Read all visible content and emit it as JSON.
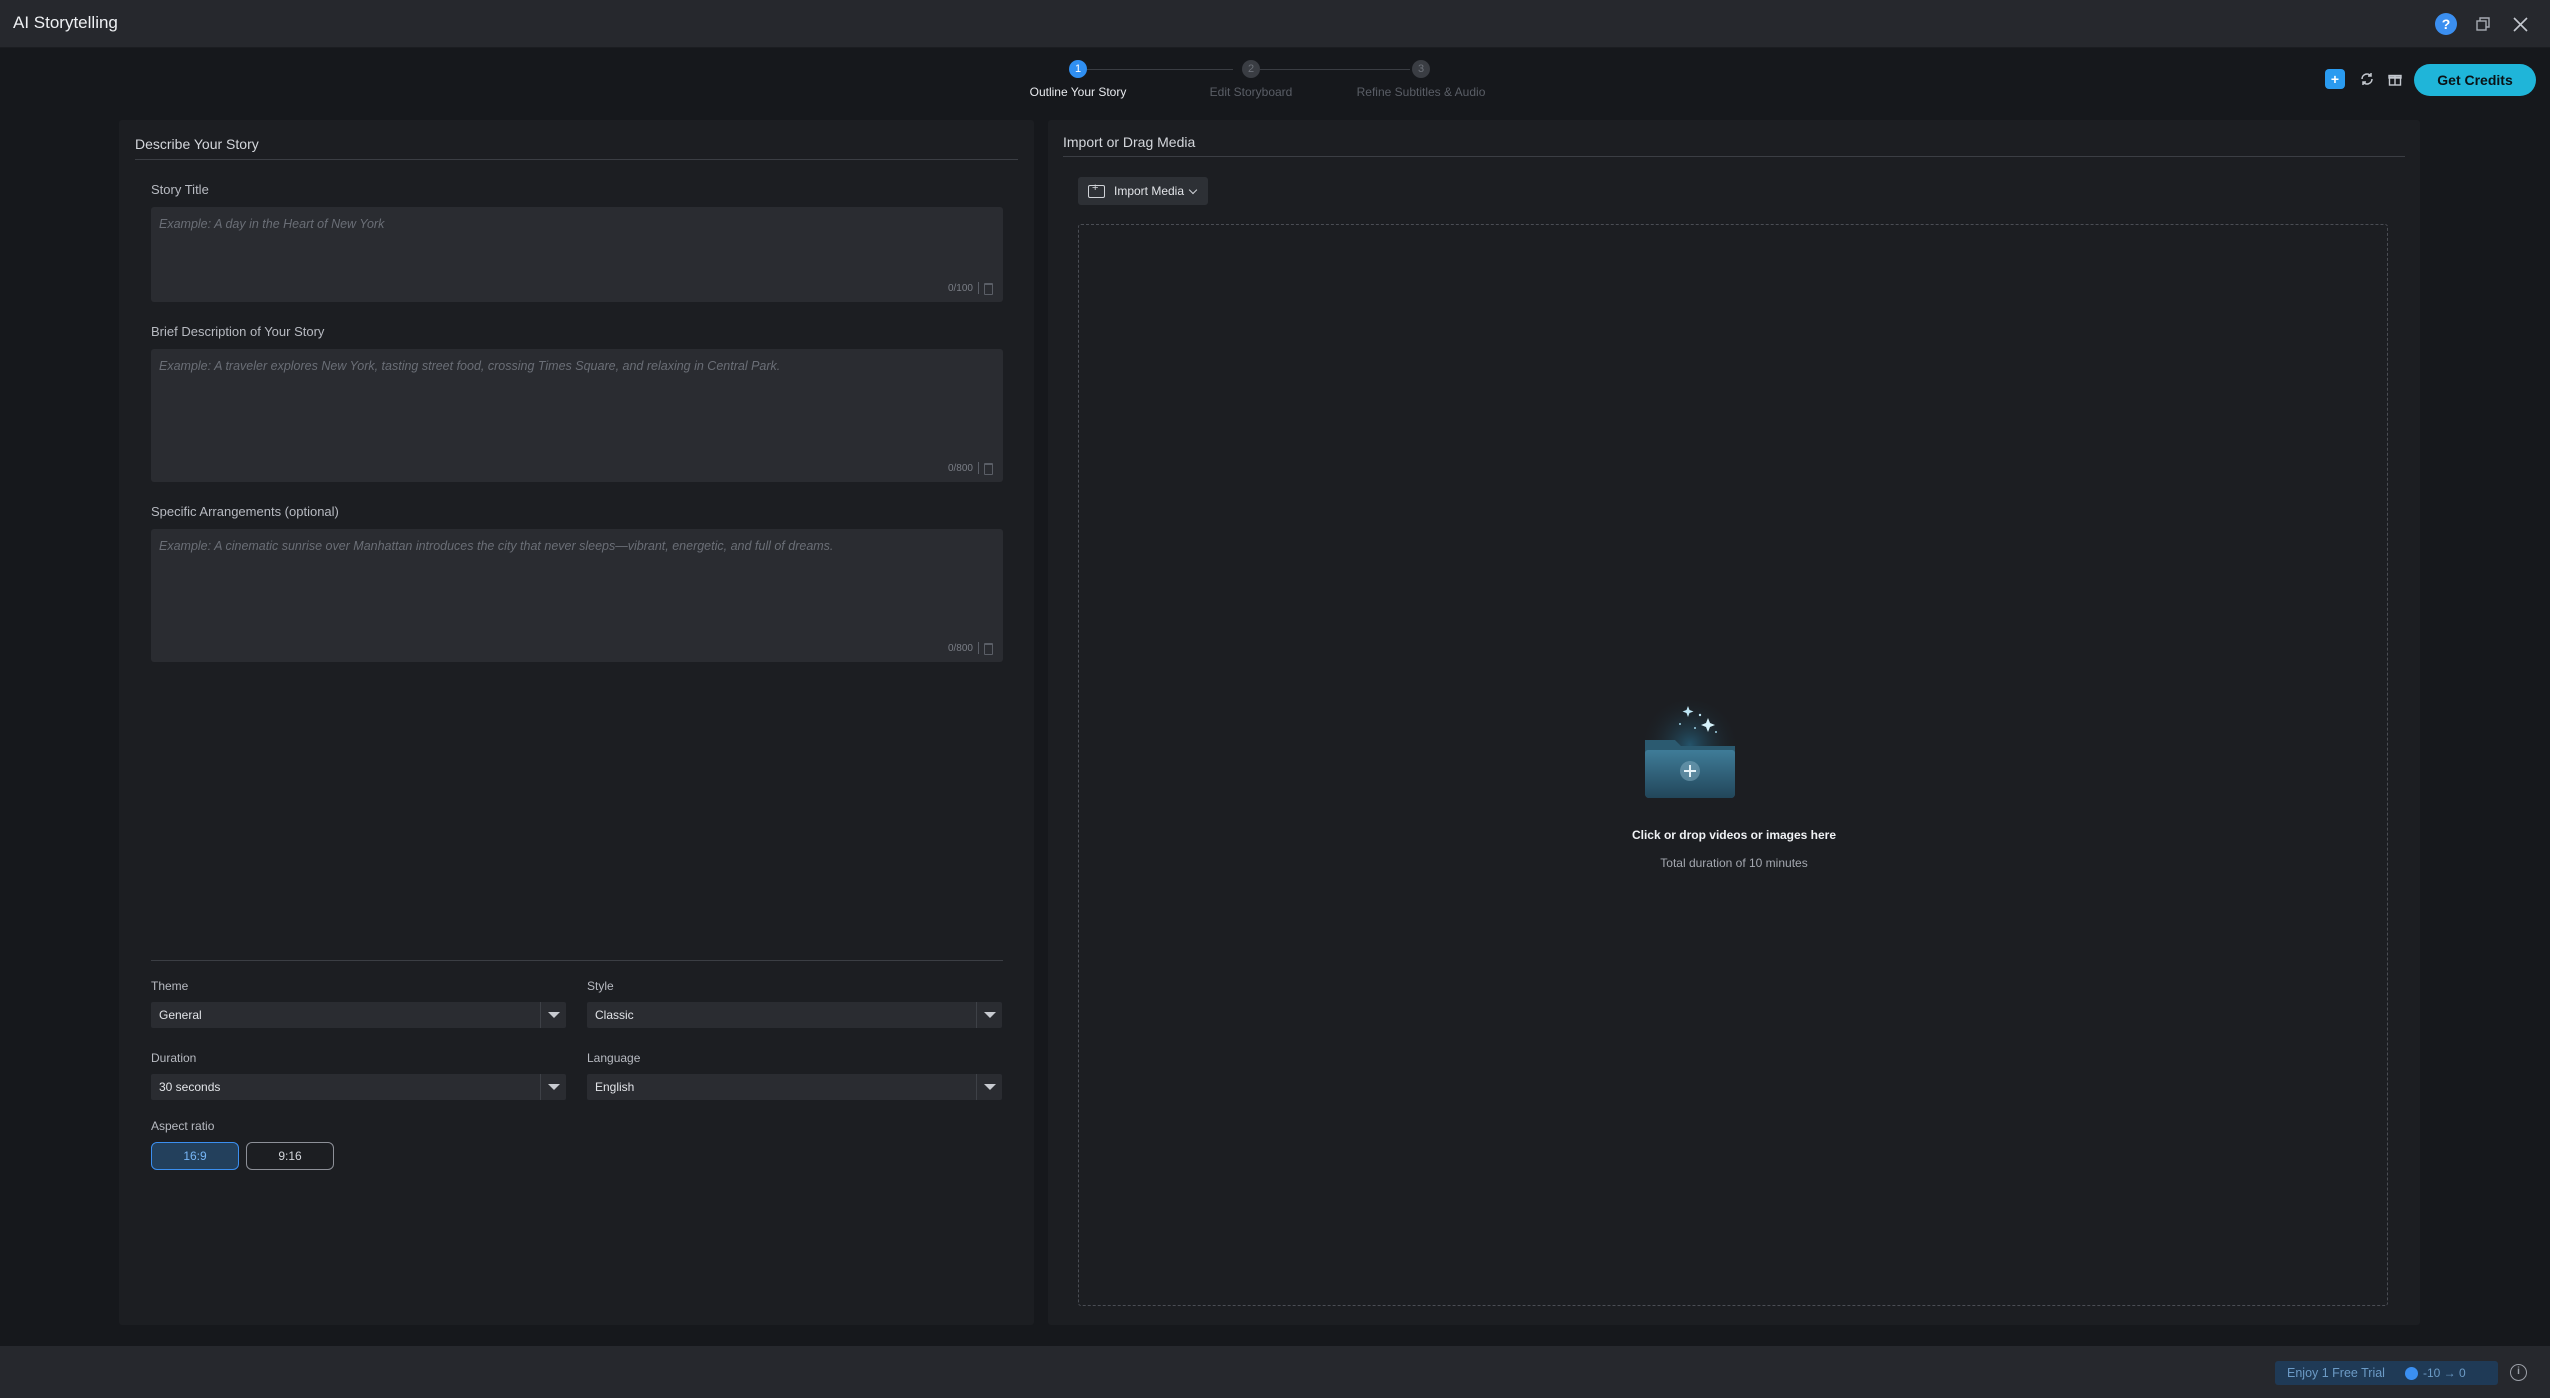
{
  "app": {
    "title": "AI Storytelling"
  },
  "stepper": {
    "steps": [
      {
        "num": "1",
        "label": "Outline Your Story"
      },
      {
        "num": "2",
        "label": "Edit Storyboard"
      },
      {
        "num": "3",
        "label": "Refine Subtitles & Audio"
      }
    ],
    "active_index": 0
  },
  "header": {
    "credits_button": "Get Credits"
  },
  "left": {
    "heading": "Describe Your Story",
    "story_title": {
      "label": "Story Title",
      "placeholder": "Example: A day in the Heart of New York",
      "count": "0/100"
    },
    "description": {
      "label": "Brief Description of Your Story",
      "placeholder": "Example: A traveler explores New York, tasting street food, crossing Times Square, and relaxing in Central Park.",
      "count": "0/800"
    },
    "arrangements": {
      "label": "Specific Arrangements (optional)",
      "placeholder": "Example: A cinematic sunrise over Manhattan introduces the city that never sleeps—vibrant, energetic, and full of dreams.",
      "count": "0/800"
    },
    "theme": {
      "label": "Theme",
      "value": "General"
    },
    "style": {
      "label": "Style",
      "value": "Classic"
    },
    "duration": {
      "label": "Duration",
      "value": "30 seconds"
    },
    "language": {
      "label": "Language",
      "value": "English"
    },
    "aspect": {
      "label": "Aspect ratio",
      "options": [
        "16:9",
        "9:16"
      ],
      "selected": "16:9"
    }
  },
  "right": {
    "heading": "Import or Drag Media",
    "import_button": "Import Media",
    "drop_main": "Click or drop videos or images here",
    "drop_sub": "Total duration of 10 minutes"
  },
  "footer": {
    "trial_text": "Enjoy 1 Free Trial",
    "credit_change": "-10 → 0"
  },
  "colors": {
    "accent": "#2f8ff2",
    "credits": "#1fb5d9",
    "background": "#16181c",
    "panel": "#1c1e22"
  }
}
